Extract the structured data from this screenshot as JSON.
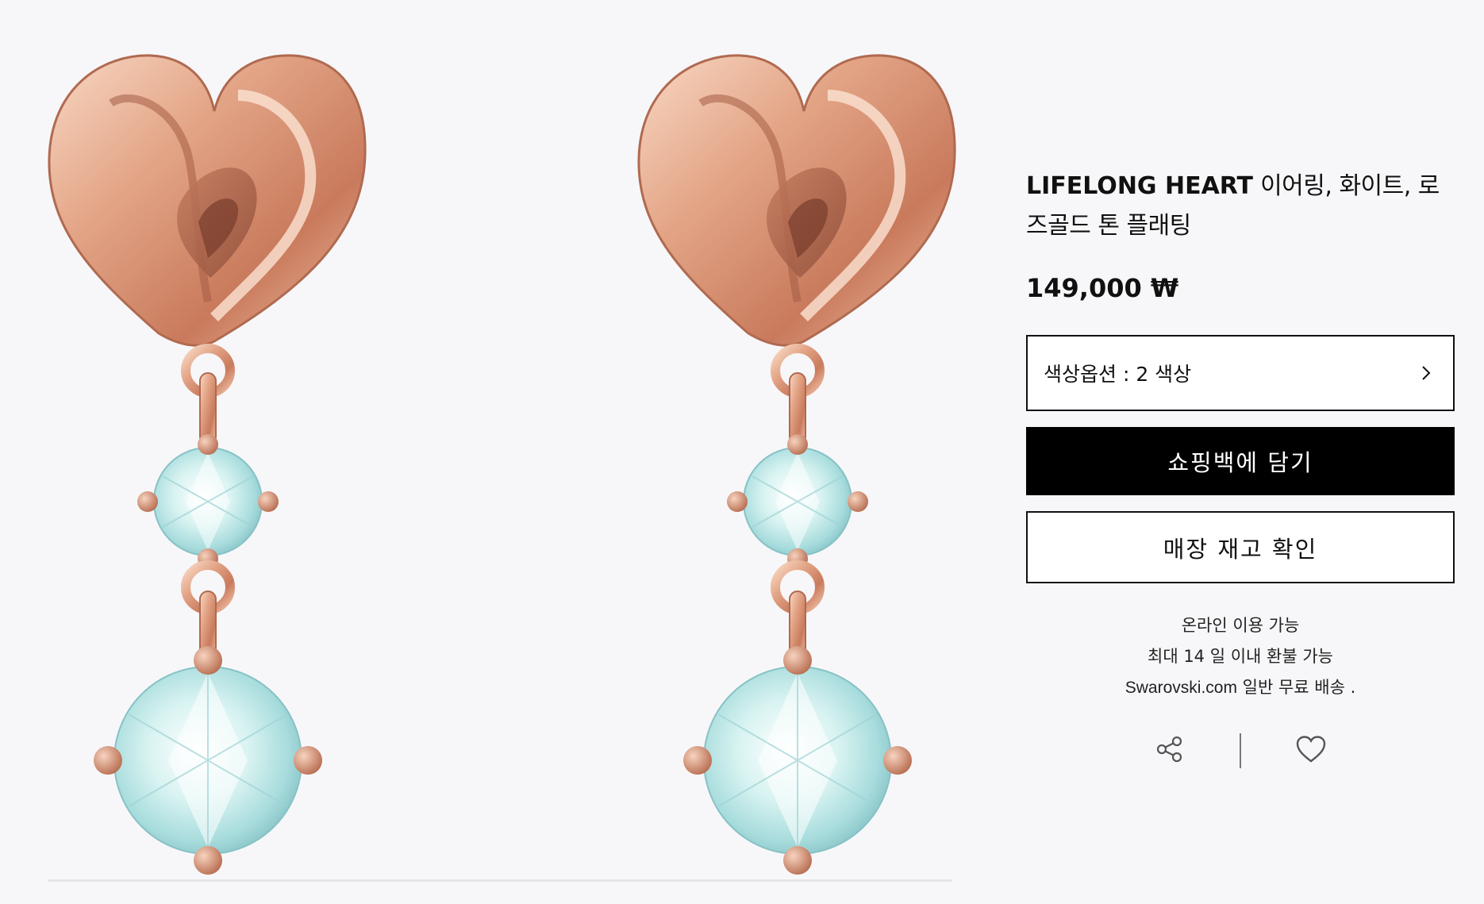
{
  "product": {
    "brand_name": "LIFELONG HEART",
    "title_rest": " 이어링, 화이트, 로즈골드 톤 플래팅",
    "price": "149,000 ₩",
    "image_alt": "",
    "color_option": {
      "label": "색상옵션 : 2 색상"
    }
  },
  "buttons": {
    "add_to_bag": "쇼핑백에 담기",
    "check_store_stock": "매장 재고 확인"
  },
  "notes": {
    "online": "온라인 이용 가능",
    "refund": "최대 14 일 이내 환불 가능",
    "shipping_domain": "Swarovski.com",
    "shipping_rest": " 일반 무료 배송 ."
  },
  "icons": {
    "share": "share-icon",
    "wishlist": "heart-icon",
    "chevron": "chevron-right-icon"
  },
  "colors": {
    "rose_gold": "#d9967a",
    "rose_gold_light": "#f6d2bd",
    "rose_gold_dark": "#a9614a",
    "crystal": "#c9eceb",
    "crystal_dark": "#8fc7cb",
    "button_black": "#000000",
    "background": "#f7f7f9"
  }
}
